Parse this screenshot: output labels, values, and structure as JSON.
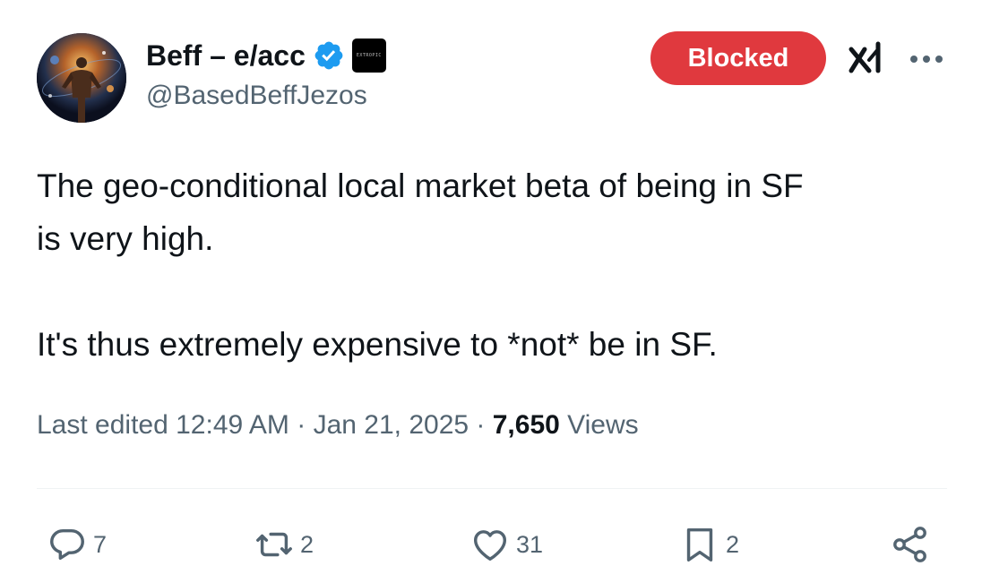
{
  "author": {
    "display_name": "Beff – e/acc",
    "handle": "@BasedBeffJezos",
    "affiliate_badge_text": "EXTROPIC",
    "verified_color": "#1d9bf0"
  },
  "header": {
    "blocked_label": "Blocked",
    "blocked_color": "#e0393e"
  },
  "tweet": {
    "paragraphs": [
      "The geo-conditional local market beta of being in SF",
      "is very high.",
      "It's thus extremely expensive to *not* be in SF."
    ]
  },
  "meta": {
    "edited_prefix": "Last edited",
    "time": "12:49 AM",
    "separator": "·",
    "date": "Jan 21, 2025",
    "views_count": "7,650",
    "views_label": "Views"
  },
  "actions": {
    "replies": "7",
    "reposts": "2",
    "likes": "31",
    "bookmarks": "2"
  },
  "icons": {
    "reply": "reply-icon",
    "repost": "repost-icon",
    "like": "heart-icon",
    "bookmark": "bookmark-icon",
    "share": "share-icon",
    "grok": "grok-icon",
    "more": "more-icon",
    "verified": "verified-badge-icon"
  }
}
